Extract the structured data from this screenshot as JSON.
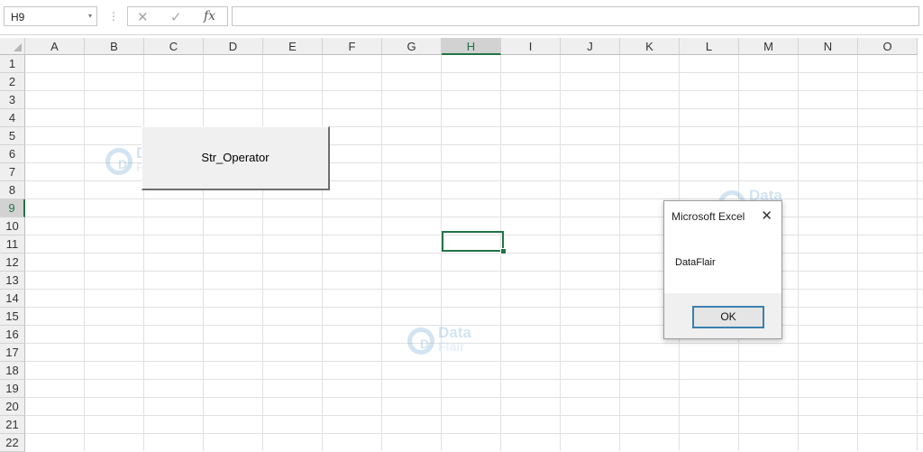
{
  "formula_bar": {
    "name_box": "H9",
    "name_box_dropdown": "▾",
    "separator": "⋮",
    "cancel_icon": "✕",
    "enter_icon": "✓",
    "fx_icon": "fx",
    "formula_value": ""
  },
  "sheet": {
    "columns": [
      "A",
      "B",
      "C",
      "D",
      "E",
      "F",
      "G",
      "H",
      "I",
      "J",
      "K",
      "L",
      "M",
      "N",
      "O"
    ],
    "rows": [
      "1",
      "2",
      "3",
      "4",
      "5",
      "6",
      "7",
      "8",
      "9",
      "10",
      "11",
      "12",
      "13",
      "14",
      "15",
      "16",
      "17",
      "18",
      "19",
      "20",
      "21",
      "22"
    ],
    "active_cell": "H9",
    "selected_column": "H",
    "selected_row": "9"
  },
  "macro_button": {
    "label": "Str_Operator"
  },
  "msgbox": {
    "title": "Microsoft Excel",
    "close_icon": "✕",
    "message": "DataFlair",
    "ok_label": "OK"
  },
  "watermark": {
    "word1": "Data",
    "word2": "Flair",
    "logo": "D"
  },
  "colors": {
    "accent": "#217346",
    "dialog_button_border": "#3c7fb1",
    "watermark": "#7fb3dc"
  }
}
